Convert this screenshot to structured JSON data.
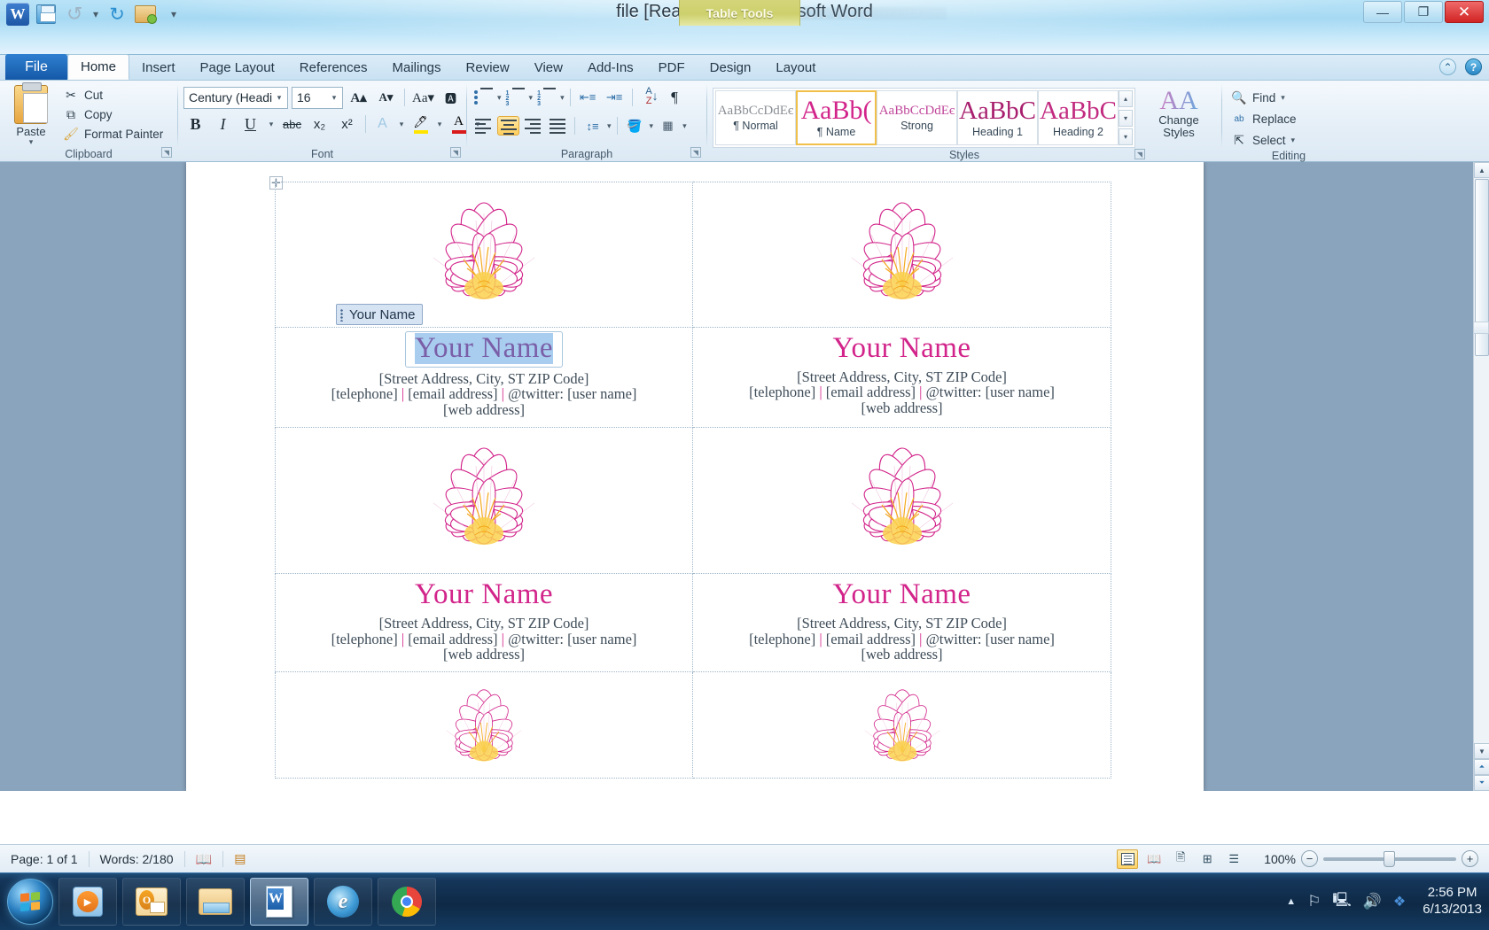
{
  "window": {
    "title": "file [Read-Only] - Microsoft Word",
    "contextual_tab_group": "Table Tools",
    "quick_access": [
      "save-icon",
      "undo-icon",
      "redo-icon",
      "print-preview-icon",
      "customize-qat-icon"
    ],
    "controls": {
      "minimize": "—",
      "maximize": "❐",
      "close": "✕"
    }
  },
  "ribbon": {
    "tabs": [
      {
        "label": "File",
        "type": "file"
      },
      {
        "label": "Home",
        "active": true
      },
      {
        "label": "Insert"
      },
      {
        "label": "Page Layout"
      },
      {
        "label": "References"
      },
      {
        "label": "Mailings"
      },
      {
        "label": "Review"
      },
      {
        "label": "View"
      },
      {
        "label": "Add-Ins"
      },
      {
        "label": "PDF"
      },
      {
        "label": "Design",
        "contextual": true
      },
      {
        "label": "Layout",
        "contextual": true
      }
    ],
    "groups": {
      "clipboard": {
        "caption": "Clipboard",
        "paste": "Paste",
        "items": [
          "Cut",
          "Copy",
          "Format Painter"
        ]
      },
      "font": {
        "caption": "Font",
        "font_name": "Century (Headir",
        "font_size": "16",
        "buttons": [
          "B",
          "I",
          "U",
          "abc",
          "x₂",
          "x²"
        ]
      },
      "paragraph": {
        "caption": "Paragraph"
      },
      "styles": {
        "caption": "Styles",
        "change_styles": "Change Styles",
        "gallery": [
          {
            "preview": "AaBbCcDdEє",
            "name": "¶ Normal",
            "color": "#8a8f95",
            "size": "15px",
            "selected": false
          },
          {
            "preview": "AaBb(",
            "name": "¶ Name",
            "color": "#d2248a",
            "size": "30px",
            "selected": true
          },
          {
            "preview": "AaBbCcDdEє",
            "name": "Strong",
            "color": "#c0479a",
            "size": "15px",
            "selected": false
          },
          {
            "preview": "AaBbC",
            "name": "Heading 1",
            "color": "#a81f6e",
            "size": "29px",
            "selected": false
          },
          {
            "preview": "AaBbC",
            "name": "Heading 2",
            "color": "#c22b80",
            "size": "29px",
            "selected": false
          }
        ]
      },
      "editing": {
        "caption": "Editing",
        "items": [
          "Find",
          "Replace",
          "Select"
        ]
      }
    }
  },
  "document": {
    "cards": [
      {
        "name": "Your Name",
        "address": "[Street Address, City, ST  ZIP Code]",
        "contact_left": "[telephone]",
        "contact_mid": "[email address]",
        "contact_right": "@twitter: [user name]",
        "web": "[web address]",
        "selected": true,
        "content_control_tag": "Your Name"
      },
      {
        "name": "Your Name",
        "address": "[Street Address, City, ST  ZIP Code]",
        "contact_left": "[telephone]",
        "contact_mid": "[email address]",
        "contact_right": "@twitter: [user name]",
        "web": "[web address]",
        "selected": false
      },
      {
        "name": "Your Name",
        "address": "[Street Address, City, ST  ZIP Code]",
        "contact_left": "[telephone]",
        "contact_mid": "[email address]",
        "contact_right": "@twitter: [user name]",
        "web": "[web address]",
        "selected": false
      },
      {
        "name": "Your Name",
        "address": "[Street Address, City, ST  ZIP Code]",
        "contact_left": "[telephone]",
        "contact_mid": "[email address]",
        "contact_right": "@twitter: [user name]",
        "web": "[web address]",
        "selected": false
      }
    ],
    "separator": "|",
    "accent_color": "#d2248a",
    "flower_icon": "lotus-flower-icon"
  },
  "status_bar": {
    "page": "Page: 1 of 1",
    "words": "Words: 2/180",
    "proofing_icon": "spell-check-icon",
    "language_icon": "language-icon",
    "zoom": "100%",
    "views": [
      "print-layout-view",
      "full-screen-reading-view",
      "web-layout-view",
      "outline-view",
      "draft-view"
    ],
    "zoom_out": "−",
    "zoom_in": "+"
  },
  "taskbar": {
    "start": "start-orb",
    "items": [
      {
        "name": "windows-media-player-icon"
      },
      {
        "name": "outlook-icon"
      },
      {
        "name": "windows-explorer-icon"
      },
      {
        "name": "microsoft-word-icon",
        "active": true
      },
      {
        "name": "internet-explorer-icon"
      },
      {
        "name": "google-chrome-icon"
      }
    ],
    "tray": [
      "show-hidden-icons-icon",
      "action-center-flag-icon",
      "network-icon",
      "volume-icon",
      "dropbox-icon"
    ],
    "time": "2:56 PM",
    "date": "6/13/2013"
  }
}
